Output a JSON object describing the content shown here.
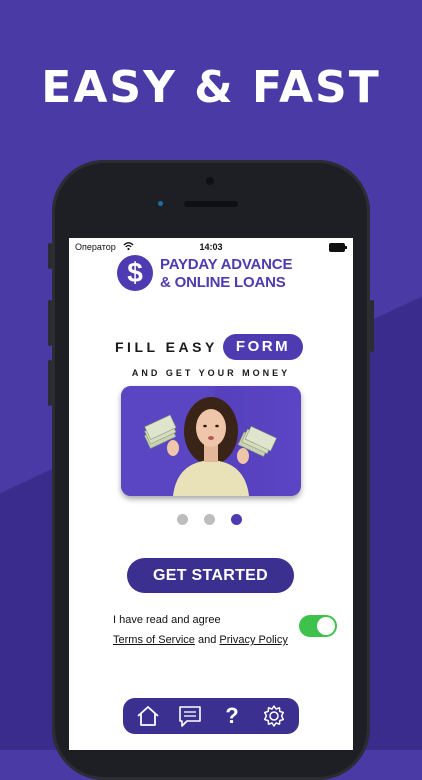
{
  "promo": {
    "headline": "EASY & FAST"
  },
  "status_bar": {
    "carrier": "Оператор",
    "time": "14:03"
  },
  "app": {
    "brand_symbol": "$",
    "brand_line1": "PAYDAY ADVANCE",
    "brand_line2": "& ONLINE LOANS"
  },
  "onboarding": {
    "fill_text": "FILL EASY",
    "form_pill": "FORM",
    "subtitle": "AND GET YOUR MONEY",
    "page_count": 3,
    "active_page": 3
  },
  "cta": {
    "label": "GET STARTED"
  },
  "terms": {
    "agree_text": "I have read and agree",
    "tos_link": "Terms of Service",
    "and_text": "and",
    "privacy_link": "Privacy Policy",
    "toggle_on": true
  },
  "tabs": [
    {
      "icon": "home-icon"
    },
    {
      "icon": "chat-icon"
    },
    {
      "icon": "help-icon",
      "glyph": "?"
    },
    {
      "icon": "settings-icon"
    }
  ],
  "colors": {
    "background": "#4a3aa6",
    "brand": "#4e3bb2",
    "button": "#3b2f8f",
    "toggle": "#3fc24c"
  }
}
